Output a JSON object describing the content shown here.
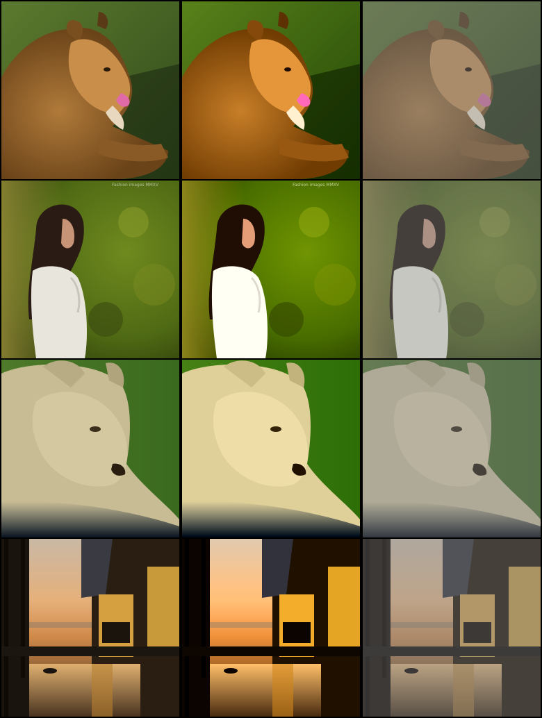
{
  "rows": [
    {
      "subject": "lioness-in-grass",
      "watermark": ""
    },
    {
      "subject": "woman-in-greenery",
      "watermark": "Fashion images MMXV"
    },
    {
      "subject": "lioness-closeup",
      "watermark": ""
    },
    {
      "subject": "dock-building-sunset",
      "watermark": ""
    }
  ],
  "columns": [
    "original",
    "enhanced",
    "hazy"
  ]
}
